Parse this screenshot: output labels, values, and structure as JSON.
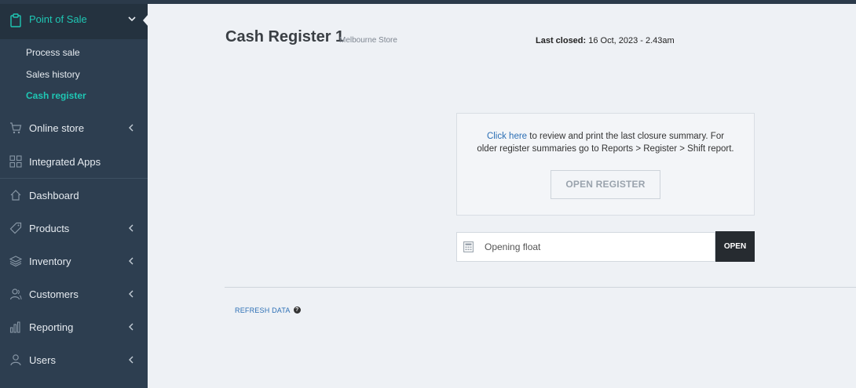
{
  "sidebar": {
    "header": {
      "label": "Point of Sale"
    },
    "sub_items": [
      {
        "label": "Process sale"
      },
      {
        "label": "Sales history"
      },
      {
        "label": "Cash register"
      }
    ],
    "items": [
      {
        "label": "Online store"
      },
      {
        "label": "Integrated Apps"
      },
      {
        "label": "Dashboard"
      },
      {
        "label": "Products"
      },
      {
        "label": "Inventory"
      },
      {
        "label": "Customers"
      },
      {
        "label": "Reporting"
      },
      {
        "label": "Users"
      }
    ]
  },
  "main": {
    "title": "Cash Register 1",
    "store": "Melbourne Store",
    "last_closed_label": "Last closed:",
    "last_closed_value": "16 Oct, 2023 - 2.43am",
    "summary": {
      "link": "Click here",
      "text_line1": " to review and print the last closure summary. For",
      "text_line2": "older register summaries go to Reports > Register > Shift report.",
      "open_register_label": "OPEN REGISTER"
    },
    "float": {
      "placeholder": "Opening float",
      "value": "",
      "open_label": "OPEN"
    },
    "refresh_label": "REFRESH DATA",
    "help_glyph": "?"
  },
  "colors": {
    "accent": "#1fc7b4",
    "sidebar_bg": "#2d3e50",
    "link": "#2c6fb5",
    "dark_button": "#262b30"
  }
}
